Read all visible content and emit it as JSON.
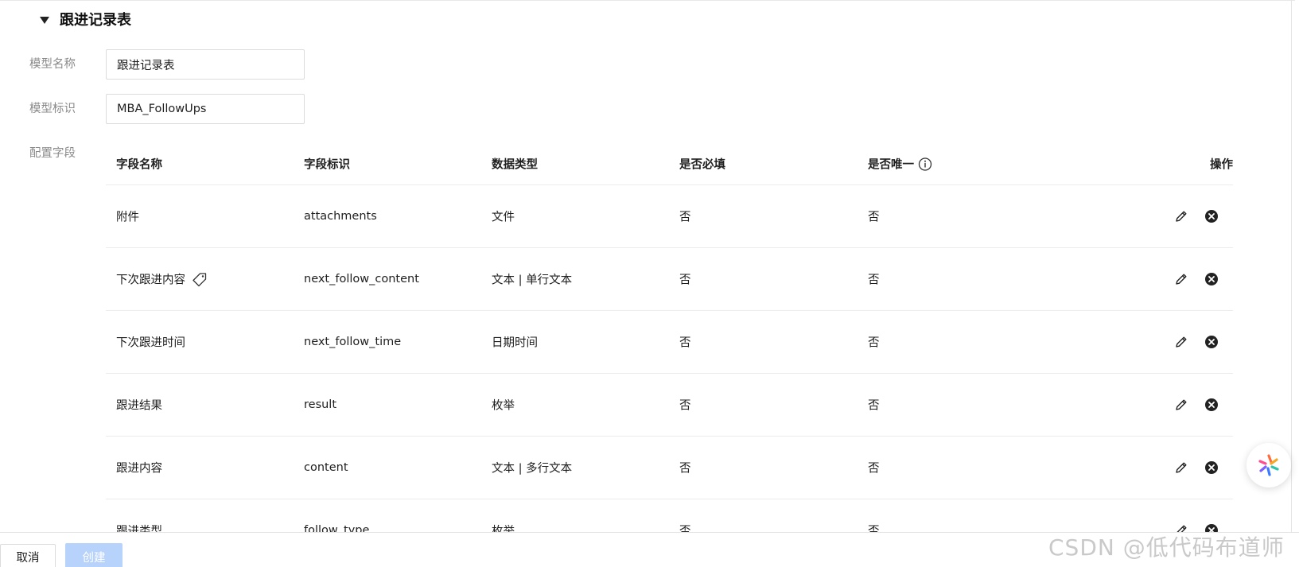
{
  "section": {
    "title": "跟进记录表"
  },
  "form": {
    "model_name_label": "模型名称",
    "model_name_value": "跟进记录表",
    "model_id_label": "模型标识",
    "model_id_value": "MBA_FollowUps",
    "fields_label": "配置字段"
  },
  "table": {
    "headers": {
      "name": "字段名称",
      "id": "字段标识",
      "type": "数据类型",
      "required": "是否必填",
      "unique": "是否唯一",
      "actions": "操作"
    },
    "rows": [
      {
        "name": "附件",
        "id": "attachments",
        "type": "文件",
        "required": "否",
        "unique": "否"
      },
      {
        "name": "下次跟进内容",
        "id": "next_follow_content",
        "type": "文本 | 单行文本",
        "required": "否",
        "unique": "否"
      },
      {
        "name": "下次跟进时间",
        "id": "next_follow_time",
        "type": "日期时间",
        "required": "否",
        "unique": "否"
      },
      {
        "name": "跟进结果",
        "id": "result",
        "type": "枚举",
        "required": "否",
        "unique": "否"
      },
      {
        "name": "跟进内容",
        "id": "content",
        "type": "文本 | 多行文本",
        "required": "否",
        "unique": "否"
      },
      {
        "name": "跟进类型",
        "id": "follow_type",
        "type": "枚举",
        "required": "否",
        "unique": "否"
      }
    ]
  },
  "footer": {
    "cancel_label": "取消",
    "create_label": "创建"
  },
  "watermark": "CSDN @低代码布道师",
  "icons": {
    "caret": "caret-down-icon",
    "info": "info-icon",
    "tag": "tag-icon",
    "edit": "pencil-icon",
    "delete": "close-circle-icon"
  },
  "colors": {
    "primary_disabled": "#b8d3fb",
    "label_gray": "#8a8a8a"
  }
}
